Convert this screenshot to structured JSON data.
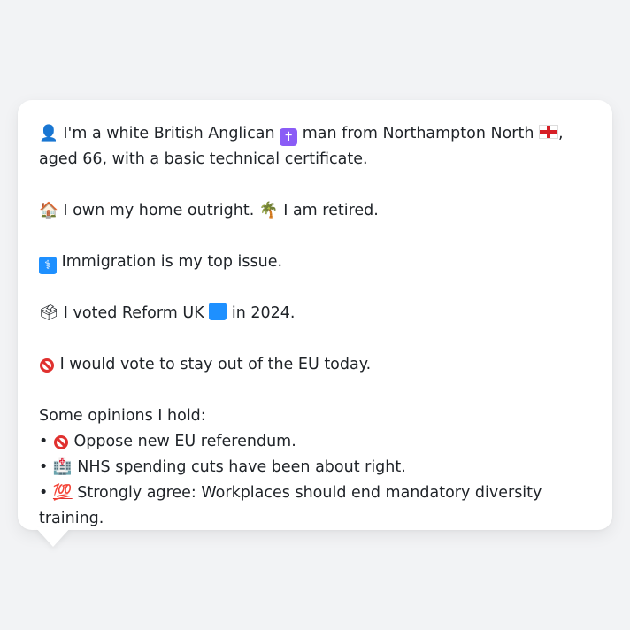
{
  "lines": {
    "identity": {
      "icon": "person-silhouette-icon",
      "text_1": "I'm a white British Anglican",
      "icon_2": "latin-cross-icon",
      "text_2": "man from Northampton North",
      "icon_3": "england-flag-icon",
      "text_3": ", aged 66, with a basic technical certificate."
    },
    "home": {
      "icon": "house-icon",
      "text_1": "I own my home outright.",
      "icon_2": "palm-tree-icon",
      "text_2": "I am retired."
    },
    "issue": {
      "icon": "passport-control-icon",
      "text": "Immigration is my top issue."
    },
    "vote": {
      "icon": "ballot-box-icon",
      "text_1": "I voted Reform UK",
      "icon_2": "blue-square-icon",
      "text_2": "in 2024."
    },
    "eu": {
      "icon": "no-entry-sign-icon",
      "text": "I would vote to stay out of the EU today."
    }
  },
  "opinions": {
    "heading": "Some opinions I hold:",
    "items": [
      {
        "bullet": "•",
        "icon": "no-entry-sign-icon",
        "text": "Oppose new EU referendum."
      },
      {
        "bullet": "•",
        "icon": "hospital-icon",
        "text": "NHS spending cuts have been about right."
      },
      {
        "bullet": "•",
        "icon": "hundred-points-icon",
        "text": "Strongly agree: Workplaces should end mandatory diversity training."
      }
    ]
  }
}
